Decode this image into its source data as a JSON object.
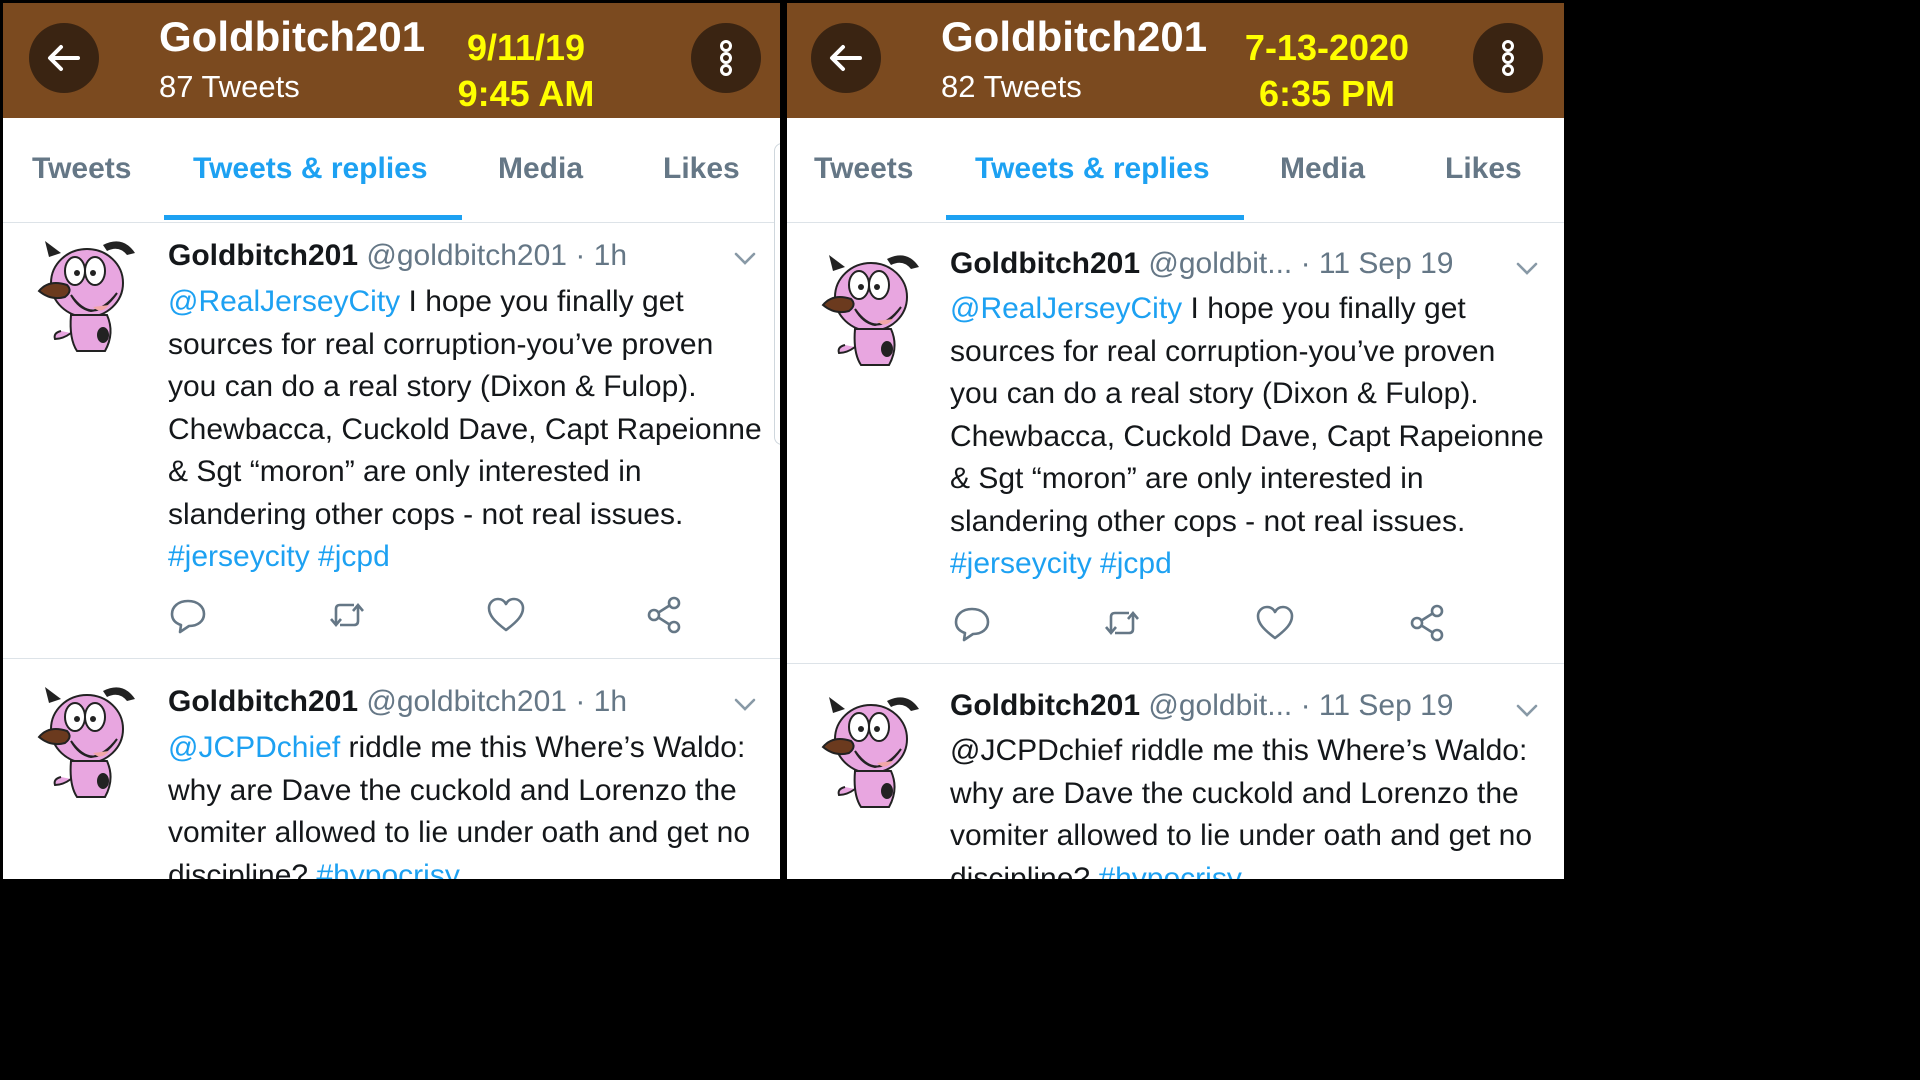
{
  "panels": [
    {
      "header": {
        "name": "Goldbitch201",
        "count": "87 Tweets",
        "stamp_date": "9/11/19",
        "stamp_time": "9:45 AM"
      },
      "tabs": [
        "Tweets",
        "Tweets & replies",
        "Media",
        "Likes"
      ],
      "tweets": [
        {
          "name": "Goldbitch201",
          "handle": "@goldbitch201",
          "time": "· 1h",
          "mention": "@RealJerseyCity",
          "text": " I hope you finally get sources for real corruption-you’ve proven you can do a real story (Dixon & Fulop).  Chewbacca, Cuckold Dave, Capt Rapeionne & Sgt “moron” are only interested in slandering other cops - not real issues. ",
          "tags": "#jerseycity #jcpd"
        },
        {
          "name": "Goldbitch201",
          "handle": "@goldbitch201",
          "time": "· 1h",
          "mention": "@JCPDchief",
          "text": " riddle me this Where’s Waldo: why are Dave the cuckold and Lorenzo the vomiter allowed to lie under oath and get no discipline? ",
          "tags": "#hypocrisy"
        }
      ]
    },
    {
      "header": {
        "name": "Goldbitch201",
        "count": "82 Tweets",
        "stamp_date": "7-13-2020",
        "stamp_time": "6:35 PM"
      },
      "tabs": [
        "Tweets",
        "Tweets & replies",
        "Media",
        "Likes"
      ],
      "tweets": [
        {
          "name": "Goldbitch201",
          "handle": "@goldbit...",
          "time": " · 11 Sep 19",
          "mention": "@RealJerseyCity",
          "text": " I hope you finally get sources for real corruption-you’ve proven you can do a real story (Dixon & Fulop).  Chewbacca, Cuckold Dave, Capt Rapeionne & Sgt “moron” are only interested in slandering other cops - not real issues. ",
          "tags": "#jerseycity #jcpd"
        },
        {
          "name": "Goldbitch201",
          "handle": "@goldbit...",
          "time": " · 11 Sep 19",
          "mention": "",
          "text": "@JCPDchief riddle me this Where’s Waldo: why are Dave the cuckold and Lorenzo the vomiter allowed to lie under oath and get no discipline? ",
          "tags": "#hypocrisy"
        }
      ]
    }
  ],
  "icons": {
    "back": "arrow-left-icon",
    "more": "vertical-dots-icon",
    "caret": "chevron-down-icon",
    "reply": "reply-icon",
    "retweet": "retweet-icon",
    "like": "heart-icon",
    "share": "share-icon"
  },
  "colors": {
    "header_bg": "#7b4a1f",
    "stamp": "#ffff00",
    "accent": "#1da1f2",
    "muted": "#657786"
  }
}
